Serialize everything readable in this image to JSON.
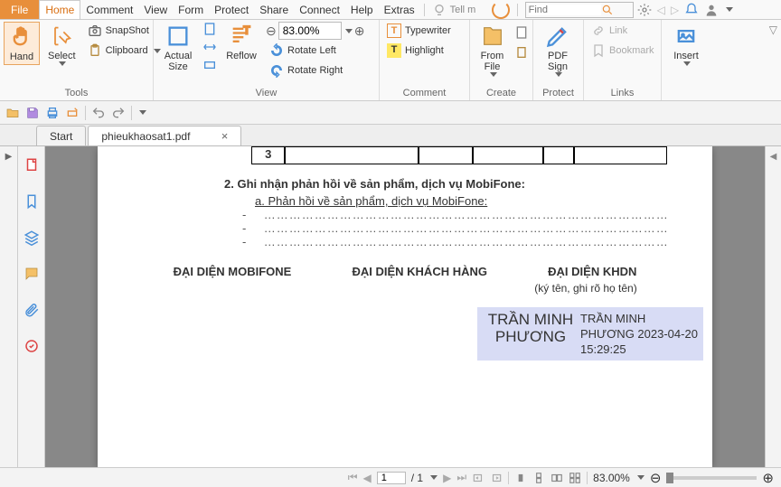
{
  "menu": {
    "file": "File",
    "items": [
      "Home",
      "Comment",
      "View",
      "Form",
      "Protect",
      "Share",
      "Connect",
      "Help",
      "Extras"
    ],
    "active": "Home",
    "tellme": "Tell m",
    "find": "Find"
  },
  "ribbon": {
    "tools": {
      "label": "Tools",
      "hand": "Hand",
      "select": "Select",
      "snapshot": "SnapShot",
      "clipboard": "Clipboard"
    },
    "view": {
      "label": "View",
      "actual": "Actual Size",
      "reflow": "Reflow",
      "zoom": "83.00%",
      "rotleft": "Rotate Left",
      "rotright": "Rotate Right"
    },
    "comment": {
      "label": "Comment",
      "typewriter": "Typewriter",
      "highlight": "Highlight"
    },
    "create": {
      "label": "Create",
      "fromfile": "From File"
    },
    "protect": {
      "label": "Protect",
      "pdfsign": "PDF Sign"
    },
    "links": {
      "label": "Links",
      "link": "Link",
      "bookmark": "Bookmark"
    },
    "insert": {
      "label": "",
      "insert": "Insert"
    }
  },
  "tabs": {
    "start": "Start",
    "doc": "phieukhaosat1.pdf"
  },
  "doc": {
    "rownum": "3",
    "heading": "2.   Ghi nhận phản hồi về sản phẩm, dịch vụ MobiFone:",
    "sub": "a.    Phản hồi về sản phẩm, dịch vụ MobiFone:",
    "sig1": "ĐẠI DIỆN MOBIFONE",
    "sig2": "ĐẠI DIỆN KHÁCH HÀNG",
    "sig3": "ĐẠI DIỆN KHDN",
    "signote": "(ký tên, ghi rõ họ tên)",
    "stamp_name": "TRẦN MINH PHƯƠNG",
    "stamp_detail": "TRẦN MINH PHƯƠNG 2023-04-20 15:29:25"
  },
  "status": {
    "page": "1",
    "total": "/ 1",
    "zoom": "83.00%"
  }
}
